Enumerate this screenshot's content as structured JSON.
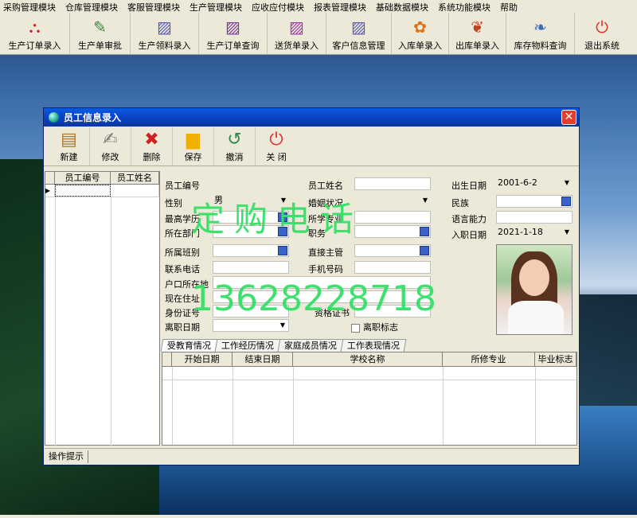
{
  "menu": [
    "采购管理模块",
    "仓库管理模块",
    "客服管理模块",
    "生产管理模块",
    "应收应付模块",
    "报表管理模块",
    "基础数据模块",
    "系统功能模块",
    "帮助"
  ],
  "toolbar": [
    {
      "label": "生产订单录入",
      "icon": "pdf-icon",
      "color": "#d02020"
    },
    {
      "label": "生产单审批",
      "icon": "pencil-icon",
      "color": "#3a8a3a"
    },
    {
      "label": "生产领料录入",
      "icon": "document-icon",
      "color": "#5a5ab0"
    },
    {
      "label": "生产订单查询",
      "icon": "document-icon",
      "color": "#7a3a9a"
    },
    {
      "label": "送货单录入",
      "icon": "document-icon",
      "color": "#9a3aaa"
    },
    {
      "label": "客户信息管理",
      "icon": "document-icon",
      "color": "#5a5ab0"
    },
    {
      "label": "入库单录入",
      "icon": "flower-icon",
      "color": "#e07010"
    },
    {
      "label": "出库单录入",
      "icon": "butterfly-icon",
      "color": "#c04020"
    },
    {
      "label": "库存物料查询",
      "icon": "feather-icon",
      "color": "#3a6ab0"
    },
    {
      "label": "退出系统",
      "icon": "power-icon",
      "color": "#e03030"
    }
  ],
  "window": {
    "title": "员工信息录入",
    "tools": [
      {
        "label": "新建",
        "icon": "notepad-icon",
        "glyph": "📋"
      },
      {
        "label": "修改",
        "icon": "edit-icon",
        "glyph": "✍"
      },
      {
        "label": "删除",
        "icon": "delete-icon",
        "glyph": "✖"
      },
      {
        "label": "保存",
        "icon": "save-icon",
        "glyph": "💾"
      },
      {
        "label": "撤消",
        "icon": "undo-icon",
        "glyph": "↺"
      },
      {
        "label": "关 闭",
        "icon": "close-icon",
        "glyph": "⏻"
      }
    ],
    "left_grid": {
      "headers": [
        "员工编号",
        "员工姓名"
      ]
    },
    "form": {
      "emp_no": "员工编号",
      "emp_name": "员工姓名",
      "birth": "出生日期",
      "birth_val": "2001-6-2",
      "gender": "性别",
      "gender_val": "男",
      "marital": "婚姻状况",
      "ethnic": "民族",
      "edu": "最高学历",
      "major": "所学专业",
      "lang": "语言能力",
      "dept": "所在部门",
      "position": "职务",
      "join": "入职日期",
      "join_val": "2021-1-18",
      "team": "所属班别",
      "supervisor": "直接主管",
      "phone": "联系电话",
      "mobile": "手机号码",
      "hukou": "户口所在地",
      "address": "现在住址",
      "idcard": "身份证号",
      "cert": "资格证书",
      "leave_date": "离职日期",
      "leave_flag": "离职标志"
    },
    "tabs": [
      "受教育情况",
      "工作经历情况",
      "家庭成员情况",
      "工作表现情况"
    ],
    "grid_headers": [
      "开始日期",
      "结束日期",
      "学校名称",
      "所修专业",
      "毕业标志"
    ],
    "status": "操作提示"
  },
  "watermark": {
    "text": "定购电话",
    "phone": "13628228718",
    "color": "#33e066"
  }
}
